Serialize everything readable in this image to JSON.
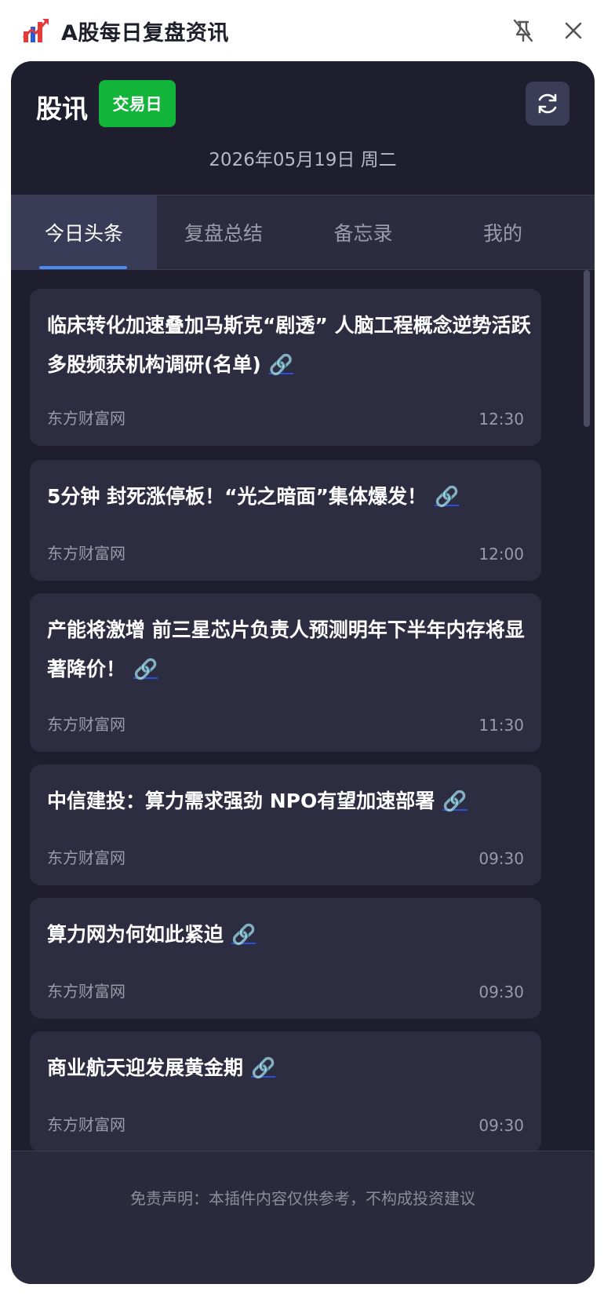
{
  "window": {
    "title": "A股每日复盘资讯",
    "logo_icon": "stock-chart-icon",
    "pin_icon": "unpin-icon",
    "close_icon": "close-icon"
  },
  "header": {
    "brand": "股讯",
    "badge": "交易日",
    "date": "2026年05月19日 周二",
    "refresh_icon": "refresh-icon"
  },
  "tabs": [
    {
      "label": "今日头条",
      "active": true
    },
    {
      "label": "复盘总结",
      "active": false
    },
    {
      "label": "备忘录",
      "active": false
    },
    {
      "label": "我的",
      "active": false
    }
  ],
  "news": [
    {
      "title": "临床转化加速叠加马斯克“剧透” 人脑工程概念逆势活跃 多股频获机构调研(名单)",
      "link_icon": "🔗",
      "source": "东方财富网",
      "time": "12:30"
    },
    {
      "title": "5分钟 封死涨停板！“光之暗面”集体爆发！",
      "link_icon": "🔗",
      "source": "东方财富网",
      "time": "12:00"
    },
    {
      "title": "产能将激增 前三星芯片负责人预测明年下半年内存将显著降价！",
      "link_icon": "🔗",
      "source": "东方财富网",
      "time": "11:30"
    },
    {
      "title": "中信建投：算力需求强劲 NPO有望加速部署",
      "link_icon": "🔗",
      "source": "东方财富网",
      "time": "09:30"
    },
    {
      "title": "算力网为何如此紧迫",
      "link_icon": "🔗",
      "source": "东方财富网",
      "time": "09:30"
    },
    {
      "title": "商业航天迎发展黄金期",
      "link_icon": "🔗",
      "source": "东方财富网",
      "time": "09:30"
    }
  ],
  "footer": {
    "disclaimer": "免责声明：本插件内容仅供参考，不构成投资建议"
  },
  "colors": {
    "panel_bg": "#1e1e2e",
    "card_bg": "#2d2d42",
    "badge_green": "#12b43a",
    "tab_indicator": "#4e8bf0",
    "link_blue": "#2b4fd8"
  }
}
